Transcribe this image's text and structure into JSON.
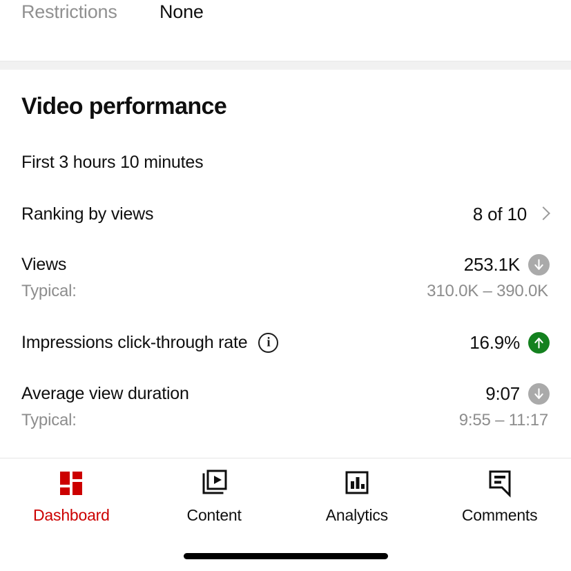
{
  "top_row": {
    "label": "Restrictions",
    "value": "None"
  },
  "performance": {
    "title": "Video performance",
    "subtitle": "First 3 hours 10 minutes",
    "metrics": [
      {
        "label": "Ranking by views",
        "value": "8 of 10",
        "accessory": "chevron-right-icon"
      },
      {
        "label": "Views",
        "value": "253.1K",
        "trend": "down",
        "typical_label": "Typical:",
        "typical_value": "310.0K – 390.0K"
      },
      {
        "label": "Impressions click-through rate",
        "info": "info-icon",
        "value": "16.9%",
        "trend": "up"
      },
      {
        "label": "Average view duration",
        "value": "9:07",
        "trend": "down",
        "typical_label": "Typical:",
        "typical_value": "9:55 – 11:17"
      }
    ]
  },
  "bottom_nav": {
    "items": [
      {
        "label": "Dashboard",
        "icon": "dashboard-grid-icon",
        "active": true
      },
      {
        "label": "Content",
        "icon": "video-stack-icon",
        "active": false
      },
      {
        "label": "Analytics",
        "icon": "bar-chart-icon",
        "active": false
      },
      {
        "label": "Comments",
        "icon": "comment-bubble-icon",
        "active": false
      }
    ]
  },
  "colors": {
    "brand_red": "#cc0000",
    "trend_up_green": "#14811f",
    "trend_down_gray": "#aaaaaa",
    "text_primary": "#0f0f0f",
    "text_secondary": "#8d8d8d",
    "section_divider": "#f1f1f1"
  }
}
